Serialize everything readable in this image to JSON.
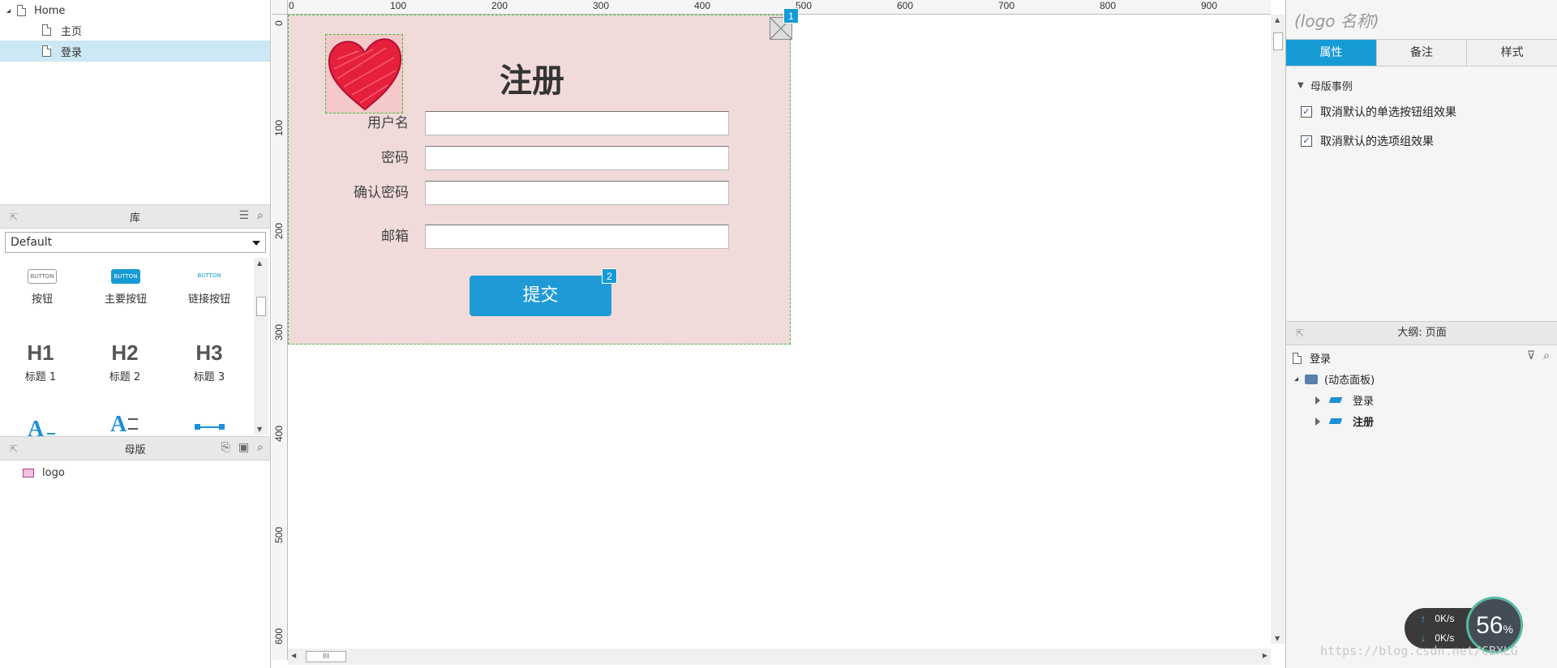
{
  "sitemap": {
    "root": "Home",
    "pages": [
      "主页",
      "登录"
    ]
  },
  "library": {
    "title": "库",
    "selected": "Default",
    "items": [
      {
        "thumb": "BUTTON",
        "label": "按钮"
      },
      {
        "thumb": "BUTTON",
        "label": "主要按钮"
      },
      {
        "thumb": "BUTTON",
        "label": "链接按钮"
      },
      {
        "thumb": "H1",
        "label": "标题 1"
      },
      {
        "thumb": "H2",
        "label": "标题 2"
      },
      {
        "thumb": "H3",
        "label": "标题 3"
      }
    ]
  },
  "masters": {
    "title": "母版",
    "items": [
      "logo"
    ]
  },
  "ruler": {
    "top": [
      "0",
      "100",
      "200",
      "300",
      "400",
      "500",
      "600",
      "700",
      "800",
      "900"
    ],
    "left": [
      "0",
      "100",
      "200",
      "300",
      "400",
      "500",
      "600"
    ]
  },
  "form": {
    "title": "注册",
    "labels": [
      "用户名",
      "密码",
      "确认密码",
      "邮箱"
    ],
    "submit": "提交",
    "badge_close": "1",
    "badge_submit": "2"
  },
  "properties": {
    "title": "(logo 名称)",
    "tabs": [
      "属性",
      "备注",
      "样式"
    ],
    "section": "母版事例",
    "options": [
      "取消默认的单选按钮组效果",
      "取消默认的选项组效果"
    ]
  },
  "outline": {
    "title": "大纲: 页面",
    "page": "登录",
    "panel": "(动态面板)",
    "states": [
      "登录",
      "注册"
    ]
  },
  "speed": {
    "up": "0K/s",
    "down": "0K/s",
    "percent": "56",
    "percent_unit": "%"
  },
  "watermark": "https://blog.csdn.net/CBXLG",
  "colors": {
    "accent": "#169bd5",
    "artboard": "#f0dada",
    "selection": "#cce8f4"
  }
}
